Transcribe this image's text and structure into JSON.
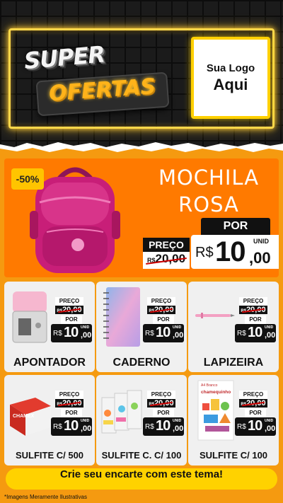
{
  "header": {
    "title_line1": "SUPER",
    "title_line2": "OFERTAS",
    "logo_line1": "Sua Logo",
    "logo_line2": "Aqui"
  },
  "featured": {
    "discount": "-50%",
    "name_line1": "MOCHILA",
    "name_line2": "ROSA",
    "por_label": "POR",
    "preco_label": "PREÇO",
    "old_currency": "R$",
    "old_price": "20,00",
    "new_currency": "R$",
    "new_price_int": "10",
    "new_price_dec": ",00",
    "unit": "UNID"
  },
  "products": [
    {
      "name": "APONTADOR",
      "preco_label": "PREÇO",
      "old_currency": "R$",
      "old_price": "20,00",
      "por_label": "POR",
      "new_currency": "R$",
      "new_int": "10",
      "new_dec": ",00",
      "unit": "UNID"
    },
    {
      "name": "CADERNO",
      "preco_label": "PREÇO",
      "old_currency": "R$",
      "old_price": "20,00",
      "por_label": "POR",
      "new_currency": "R$",
      "new_int": "10",
      "new_dec": ",00",
      "unit": "UNID"
    },
    {
      "name": "LAPIZEIRA",
      "preco_label": "PREÇO",
      "old_currency": "R$",
      "old_price": "20,00",
      "por_label": "POR",
      "new_currency": "R$",
      "new_int": "10",
      "new_dec": ",00",
      "unit": "UNID"
    },
    {
      "name": "SULFITE C/ 500",
      "preco_label": "PREÇO",
      "old_currency": "R$",
      "old_price": "20,00",
      "por_label": "POR",
      "new_currency": "R$",
      "new_int": "10",
      "new_dec": ",00",
      "unit": "UNID",
      "img_text": "CHAMEX"
    },
    {
      "name": "SULFITE C. C/ 100",
      "preco_label": "PREÇO",
      "old_currency": "R$",
      "old_price": "20,00",
      "por_label": "POR",
      "new_currency": "R$",
      "new_int": "10",
      "new_dec": ",00",
      "unit": "UNID"
    },
    {
      "name": "SULFITE C/ 100",
      "preco_label": "PREÇO",
      "old_currency": "R$",
      "old_price": "20,00",
      "por_label": "POR",
      "new_currency": "R$",
      "new_int": "10",
      "new_dec": ",00",
      "unit": "UNID",
      "img_text": "chamequinho",
      "img_sub": "A4 Branco"
    }
  ],
  "footer": {
    "cta": "Crie seu encarte com este tema!",
    "disclaimer": "*Imagens Meramente Ilustrativas"
  },
  "colors": {
    "background": "#f59a10",
    "featured_bg": "#ff7a00",
    "neon": "#ffd84a",
    "accent_yellow": "#ffd200",
    "bag_pink": "#c81e78"
  }
}
